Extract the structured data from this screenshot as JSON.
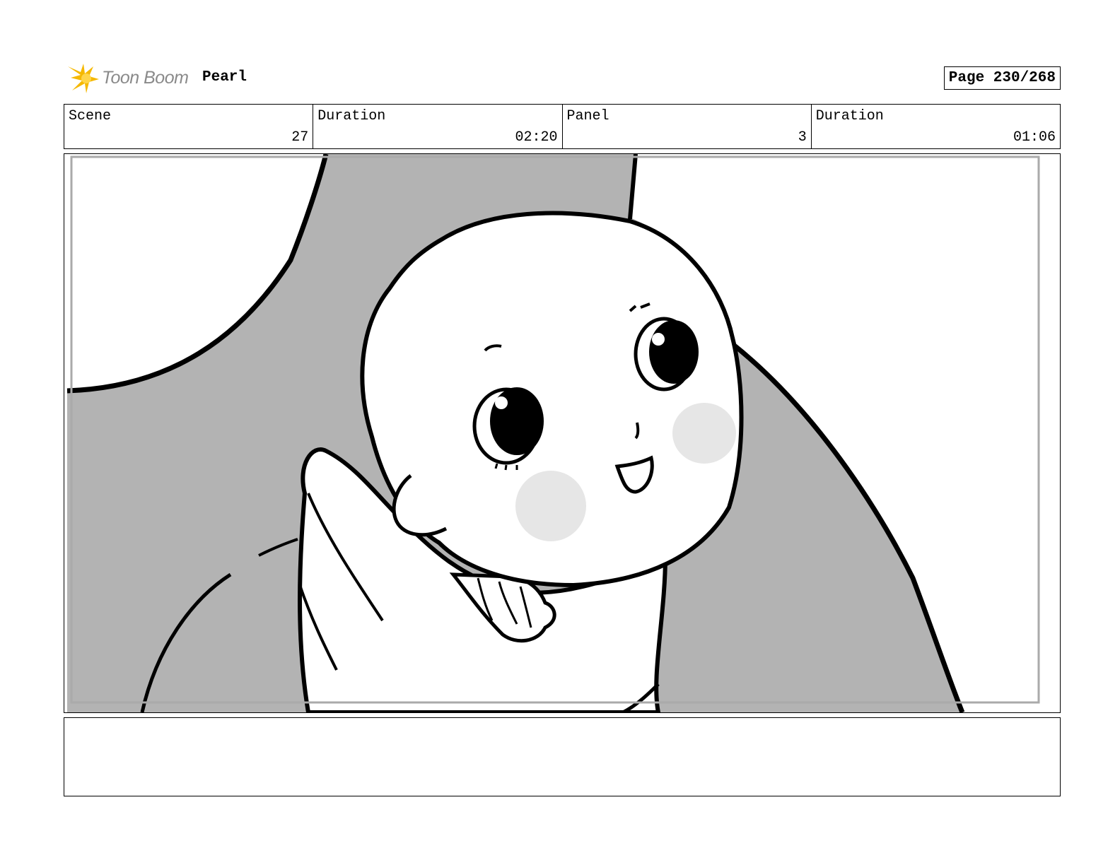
{
  "header": {
    "logo_text": "Toon Boom",
    "project": "Pearl",
    "page": "Page 230/268"
  },
  "info": [
    {
      "label": "Scene",
      "value": "27"
    },
    {
      "label": "Duration",
      "value": "02:20"
    },
    {
      "label": "Panel",
      "value": "3"
    },
    {
      "label": "Duration",
      "value": "01:06"
    }
  ],
  "notes": {
    "text": ""
  },
  "colors": {
    "background_gray": "#b3b3b3",
    "blush": "#e6e6e6",
    "logo_yellow": "#f5b800"
  }
}
